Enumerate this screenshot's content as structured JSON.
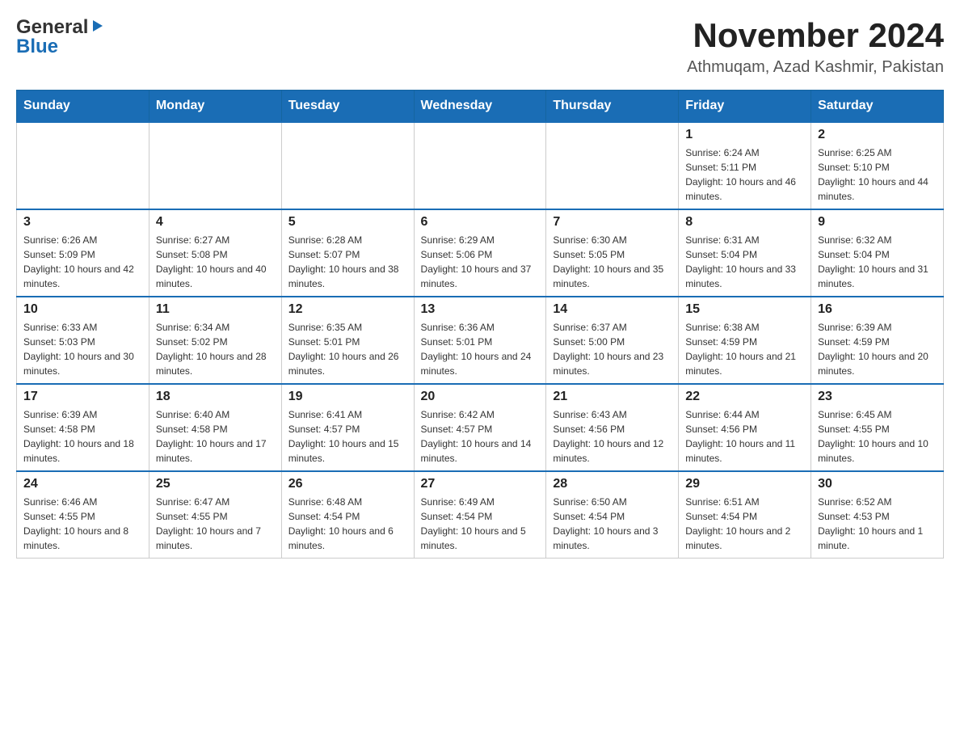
{
  "header": {
    "logo_general": "General",
    "logo_blue": "Blue",
    "month_title": "November 2024",
    "location": "Athmuqam, Azad Kashmir, Pakistan"
  },
  "days_of_week": [
    "Sunday",
    "Monday",
    "Tuesday",
    "Wednesday",
    "Thursday",
    "Friday",
    "Saturday"
  ],
  "weeks": [
    {
      "days": [
        {
          "number": "",
          "info": ""
        },
        {
          "number": "",
          "info": ""
        },
        {
          "number": "",
          "info": ""
        },
        {
          "number": "",
          "info": ""
        },
        {
          "number": "",
          "info": ""
        },
        {
          "number": "1",
          "info": "Sunrise: 6:24 AM\nSunset: 5:11 PM\nDaylight: 10 hours and 46 minutes."
        },
        {
          "number": "2",
          "info": "Sunrise: 6:25 AM\nSunset: 5:10 PM\nDaylight: 10 hours and 44 minutes."
        }
      ]
    },
    {
      "days": [
        {
          "number": "3",
          "info": "Sunrise: 6:26 AM\nSunset: 5:09 PM\nDaylight: 10 hours and 42 minutes."
        },
        {
          "number": "4",
          "info": "Sunrise: 6:27 AM\nSunset: 5:08 PM\nDaylight: 10 hours and 40 minutes."
        },
        {
          "number": "5",
          "info": "Sunrise: 6:28 AM\nSunset: 5:07 PM\nDaylight: 10 hours and 38 minutes."
        },
        {
          "number": "6",
          "info": "Sunrise: 6:29 AM\nSunset: 5:06 PM\nDaylight: 10 hours and 37 minutes."
        },
        {
          "number": "7",
          "info": "Sunrise: 6:30 AM\nSunset: 5:05 PM\nDaylight: 10 hours and 35 minutes."
        },
        {
          "number": "8",
          "info": "Sunrise: 6:31 AM\nSunset: 5:04 PM\nDaylight: 10 hours and 33 minutes."
        },
        {
          "number": "9",
          "info": "Sunrise: 6:32 AM\nSunset: 5:04 PM\nDaylight: 10 hours and 31 minutes."
        }
      ]
    },
    {
      "days": [
        {
          "number": "10",
          "info": "Sunrise: 6:33 AM\nSunset: 5:03 PM\nDaylight: 10 hours and 30 minutes."
        },
        {
          "number": "11",
          "info": "Sunrise: 6:34 AM\nSunset: 5:02 PM\nDaylight: 10 hours and 28 minutes."
        },
        {
          "number": "12",
          "info": "Sunrise: 6:35 AM\nSunset: 5:01 PM\nDaylight: 10 hours and 26 minutes."
        },
        {
          "number": "13",
          "info": "Sunrise: 6:36 AM\nSunset: 5:01 PM\nDaylight: 10 hours and 24 minutes."
        },
        {
          "number": "14",
          "info": "Sunrise: 6:37 AM\nSunset: 5:00 PM\nDaylight: 10 hours and 23 minutes."
        },
        {
          "number": "15",
          "info": "Sunrise: 6:38 AM\nSunset: 4:59 PM\nDaylight: 10 hours and 21 minutes."
        },
        {
          "number": "16",
          "info": "Sunrise: 6:39 AM\nSunset: 4:59 PM\nDaylight: 10 hours and 20 minutes."
        }
      ]
    },
    {
      "days": [
        {
          "number": "17",
          "info": "Sunrise: 6:39 AM\nSunset: 4:58 PM\nDaylight: 10 hours and 18 minutes."
        },
        {
          "number": "18",
          "info": "Sunrise: 6:40 AM\nSunset: 4:58 PM\nDaylight: 10 hours and 17 minutes."
        },
        {
          "number": "19",
          "info": "Sunrise: 6:41 AM\nSunset: 4:57 PM\nDaylight: 10 hours and 15 minutes."
        },
        {
          "number": "20",
          "info": "Sunrise: 6:42 AM\nSunset: 4:57 PM\nDaylight: 10 hours and 14 minutes."
        },
        {
          "number": "21",
          "info": "Sunrise: 6:43 AM\nSunset: 4:56 PM\nDaylight: 10 hours and 12 minutes."
        },
        {
          "number": "22",
          "info": "Sunrise: 6:44 AM\nSunset: 4:56 PM\nDaylight: 10 hours and 11 minutes."
        },
        {
          "number": "23",
          "info": "Sunrise: 6:45 AM\nSunset: 4:55 PM\nDaylight: 10 hours and 10 minutes."
        }
      ]
    },
    {
      "days": [
        {
          "number": "24",
          "info": "Sunrise: 6:46 AM\nSunset: 4:55 PM\nDaylight: 10 hours and 8 minutes."
        },
        {
          "number": "25",
          "info": "Sunrise: 6:47 AM\nSunset: 4:55 PM\nDaylight: 10 hours and 7 minutes."
        },
        {
          "number": "26",
          "info": "Sunrise: 6:48 AM\nSunset: 4:54 PM\nDaylight: 10 hours and 6 minutes."
        },
        {
          "number": "27",
          "info": "Sunrise: 6:49 AM\nSunset: 4:54 PM\nDaylight: 10 hours and 5 minutes."
        },
        {
          "number": "28",
          "info": "Sunrise: 6:50 AM\nSunset: 4:54 PM\nDaylight: 10 hours and 3 minutes."
        },
        {
          "number": "29",
          "info": "Sunrise: 6:51 AM\nSunset: 4:54 PM\nDaylight: 10 hours and 2 minutes."
        },
        {
          "number": "30",
          "info": "Sunrise: 6:52 AM\nSunset: 4:53 PM\nDaylight: 10 hours and 1 minute."
        }
      ]
    }
  ]
}
